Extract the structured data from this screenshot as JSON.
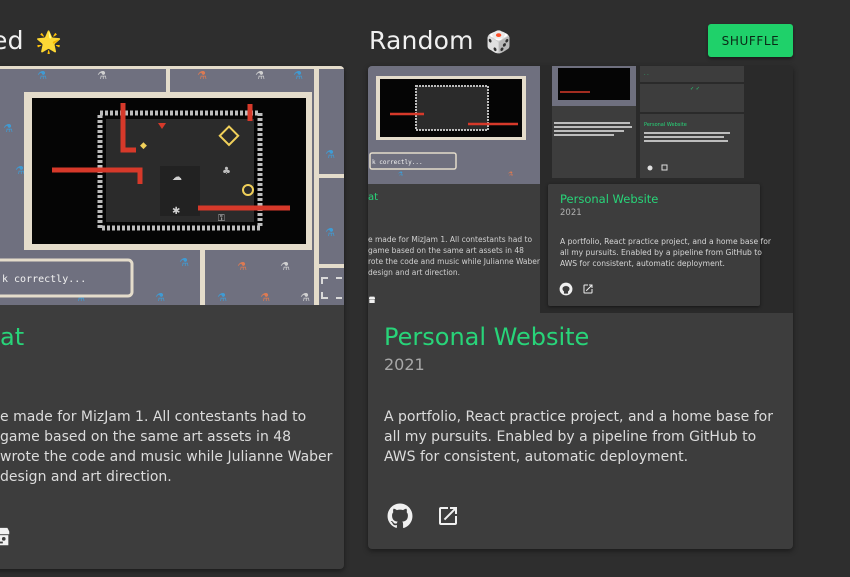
{
  "featured": {
    "title_partial": "ed",
    "emoji": "🌟"
  },
  "random": {
    "title": "Random",
    "emoji": "🎲",
    "shuffle_label": "SHUFFLE"
  },
  "left_card": {
    "title_partial": "at",
    "desc_lines": [
      "e made for MizJam 1. All contestants had to",
      "game based on the same art assets in 48",
      "wrote the code and music while Julianne Waber",
      " design and art direction."
    ],
    "game_dialog_text": "k correctly...",
    "links": [
      "itch-icon"
    ]
  },
  "right_card": {
    "title": "Personal Website",
    "year": "2021",
    "desc_lines": [
      "A portfolio, React practice project, and a home base for",
      "all my pursuits. Enabled by a pipeline from GitHub to",
      "AWS for consistent, automatic deployment."
    ],
    "links": [
      "github-icon",
      "external-link-icon"
    ]
  },
  "screenshot_preview": {
    "left_title_partial": "at",
    "left_desc_lines": [
      "e made for MizJam 1. All contestants had to",
      "game based on the same art assets in 48",
      "rote the code and music while Julianne Waber",
      " design and art direction."
    ],
    "left_dialog_text": "k correctly...",
    "mini_card": {
      "title": "Personal Website",
      "year": "2021",
      "desc_lines": [
        "A portfolio, React practice project, and a home base for",
        "all my pursuits. Enabled by a pipeline from GitHub to",
        "AWS for consistent, automatic deployment."
      ]
    }
  },
  "colors": {
    "background": "#2e2e2e",
    "card": "#3d3d3d",
    "accent_green": "#28d479",
    "button_green": "#1fd16a"
  }
}
